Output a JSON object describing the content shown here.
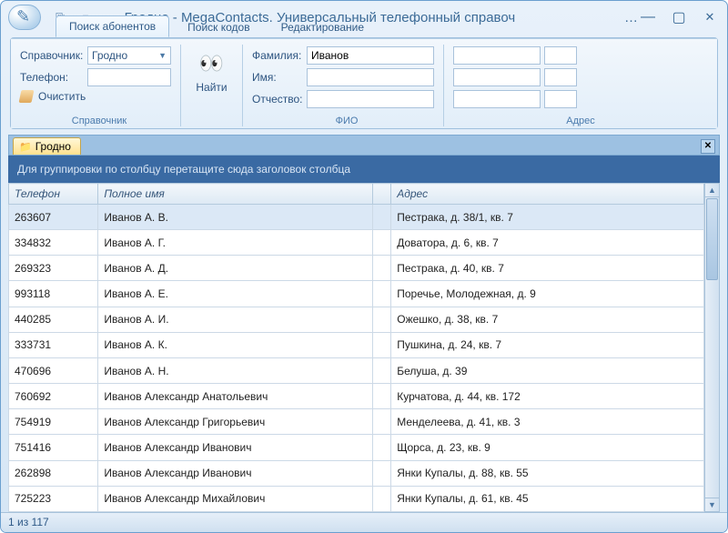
{
  "titlebar": {
    "title": "Гродно - MegaContacts. Универсальный телефонный справоч",
    "ellipsis": "…"
  },
  "qat": {
    "item1_icon": "⎘",
    "item2_icon": "▾"
  },
  "ribbon": {
    "tabs": [
      {
        "label": "Поиск абонентов",
        "active": true
      },
      {
        "label": "Поиск кодов",
        "active": false
      },
      {
        "label": "Редактирование",
        "active": false
      }
    ],
    "group_directory": {
      "label_spravochnik": "Справочник:",
      "value_spravochnik": "Гродно",
      "label_phone": "Телефон:",
      "value_phone": "",
      "label_clear": "Очистить",
      "group_title": "Справочник"
    },
    "group_find": {
      "label": "Найти"
    },
    "group_fio": {
      "label_surname": "Фамилия:",
      "value_surname": "Иванов",
      "label_name": "Имя:",
      "value_name": "",
      "label_patronymic": "Отчество:",
      "value_patronymic": "",
      "group_title": "ФИО"
    },
    "group_addr": {
      "group_title": "Адрес"
    }
  },
  "doc_tab": {
    "label": "Гродно"
  },
  "group_hint": "Для группировки по столбцу перетащите сюда заголовок столбца",
  "columns": {
    "phone": "Телефон",
    "name": "Полное имя",
    "addr": "Адрес"
  },
  "rows": [
    {
      "phone": "263607",
      "name": "Иванов А. В.",
      "addr": "Пестрака, д. 38/1, кв. 7",
      "sel": true
    },
    {
      "phone": "334832",
      "name": "Иванов А. Г.",
      "addr": "Доватора, д. 6, кв. 7"
    },
    {
      "phone": "269323",
      "name": "Иванов А. Д.",
      "addr": "Пестрака, д. 40, кв. 7"
    },
    {
      "phone": "993118",
      "name": "Иванов А. Е.",
      "addr": "Поречье, Молодежная, д. 9"
    },
    {
      "phone": "440285",
      "name": "Иванов А. И.",
      "addr": "Ожешко, д. 38, кв. 7"
    },
    {
      "phone": "333731",
      "name": "Иванов А. К.",
      "addr": "Пушкина, д. 24, кв. 7"
    },
    {
      "phone": "470696",
      "name": "Иванов А. Н.",
      "addr": "Белуша, д. 39"
    },
    {
      "phone": "760692",
      "name": "Иванов Александр Анатольевич",
      "addr": "Курчатова, д. 44, кв. 172"
    },
    {
      "phone": "754919",
      "name": "Иванов Александр Григорьевич",
      "addr": "Менделеева, д. 41, кв. 3"
    },
    {
      "phone": "751416",
      "name": "Иванов Александр Иванович",
      "addr": "Щорса, д. 23, кв. 9"
    },
    {
      "phone": "262898",
      "name": "Иванов Александр Иванович",
      "addr": "Янки Купалы, д. 88, кв. 55"
    },
    {
      "phone": "725223",
      "name": "Иванов Александр Михайлович",
      "addr": "Янки Купалы, д. 61, кв. 45"
    }
  ],
  "status": "1 из 117"
}
